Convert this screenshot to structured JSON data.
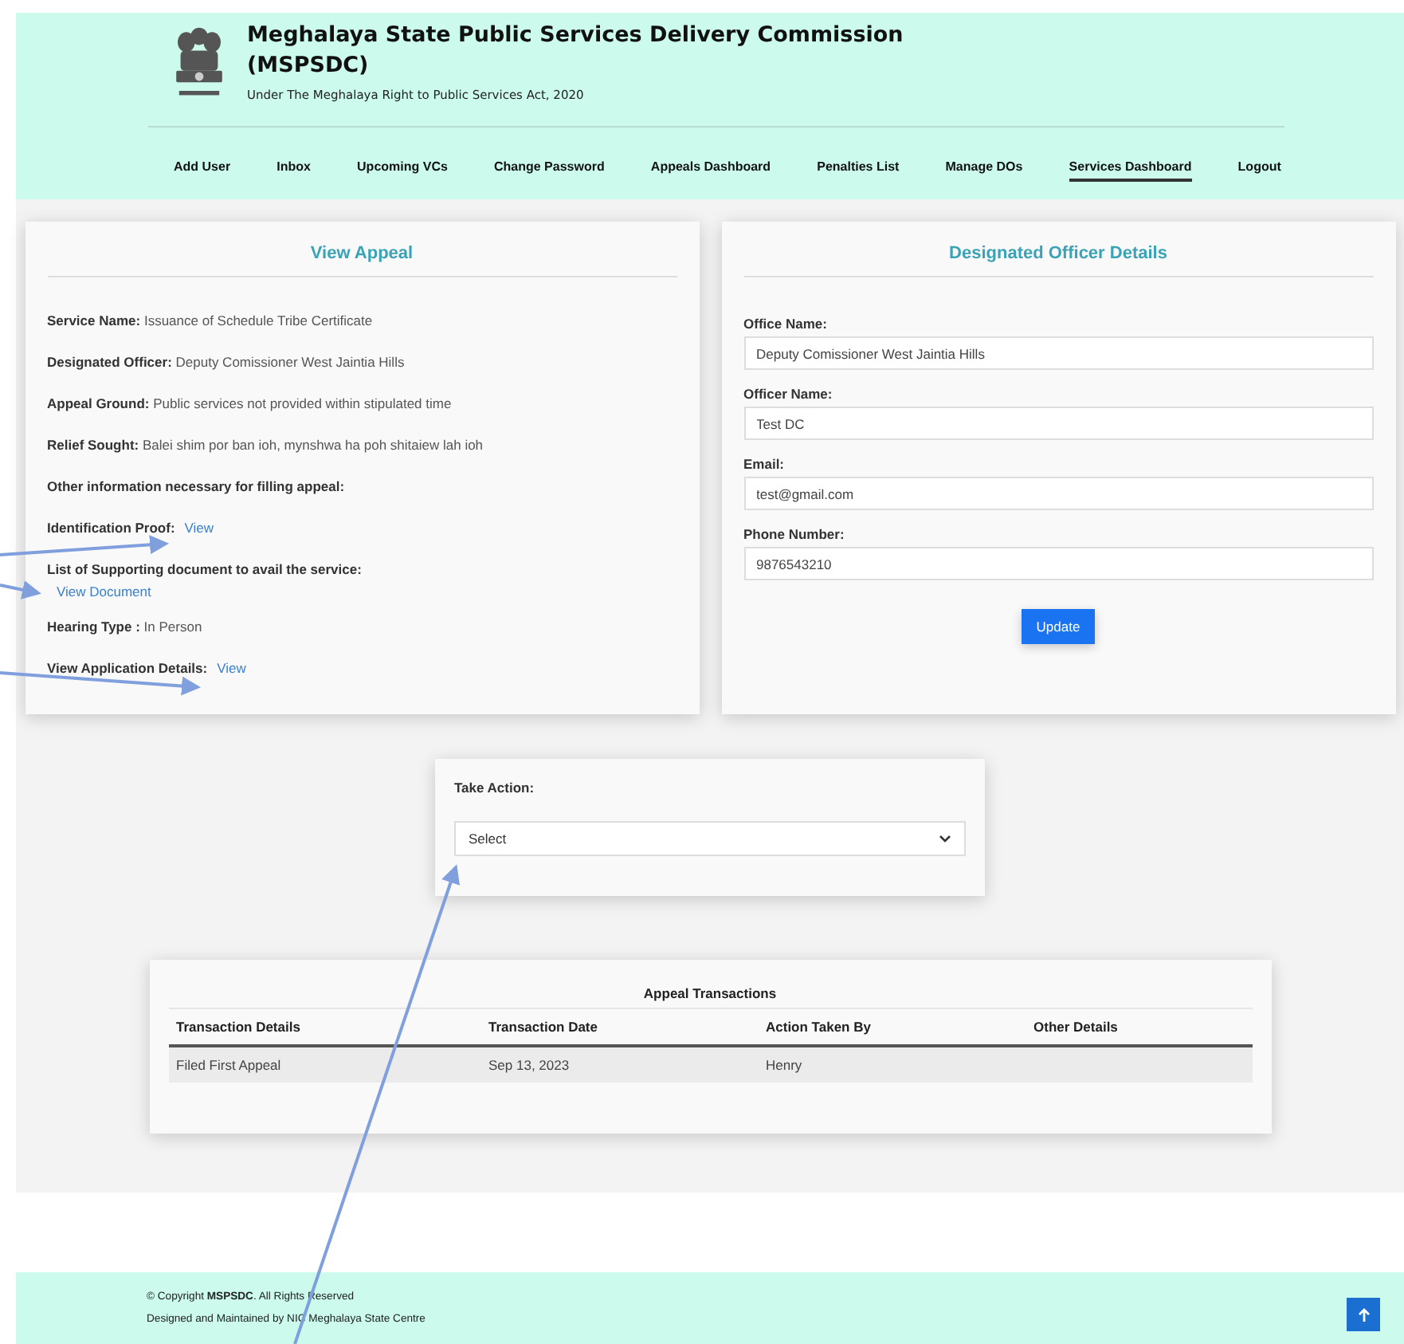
{
  "header": {
    "title_line1": "Meghalaya State Public Services Delivery Commission",
    "title_line2": "(MSPSDC)",
    "subtitle": "Under The Meghalaya Right to Public Services Act, 2020"
  },
  "nav": [
    {
      "label": "Add User",
      "selected": false
    },
    {
      "label": "Inbox",
      "selected": false
    },
    {
      "label": "Upcoming VCs",
      "selected": false
    },
    {
      "label": "Change Password",
      "selected": false
    },
    {
      "label": "Appeals Dashboard",
      "selected": false
    },
    {
      "label": "Penalties List",
      "selected": false
    },
    {
      "label": "Manage DOs",
      "selected": false
    },
    {
      "label": "Services Dashboard",
      "selected": true
    },
    {
      "label": "Logout",
      "selected": false
    }
  ],
  "view_appeal": {
    "title": "View Appeal",
    "fields": [
      {
        "kind": "text",
        "label": "Service Name:",
        "value": "Issuance of Schedule Tribe Certificate"
      },
      {
        "kind": "text",
        "label": "Designated Officer:",
        "value": "Deputy Comissioner West Jaintia Hills"
      },
      {
        "kind": "text",
        "label": "Appeal Ground:",
        "value": "Public services not provided within stipulated time"
      },
      {
        "kind": "text",
        "label": "Relief Sought:",
        "value": "Balei shim por ban ioh, mynshwa ha poh shitaiew lah ioh"
      },
      {
        "kind": "heading",
        "label": "Other information necessary for filling appeal:"
      },
      {
        "kind": "link",
        "label": "Identification Proof:",
        "link": "View"
      },
      {
        "kind": "link_below",
        "label": "List of Supporting document to avail the service:",
        "link": "View Document"
      },
      {
        "kind": "text",
        "label": "Hearing Type :",
        "value": "In Person"
      },
      {
        "kind": "link",
        "label": "View Application Details:",
        "link": "View"
      }
    ]
  },
  "officer": {
    "title": "Designated Officer Details",
    "fields": [
      {
        "label": "Office Name:",
        "value": "Deputy Comissioner West Jaintia Hills"
      },
      {
        "label": "Officer Name:",
        "value": "Test DC"
      },
      {
        "label": "Email:",
        "value": "test@gmail.com"
      },
      {
        "label": "Phone Number:",
        "value": "9876543210"
      }
    ],
    "button": "Update"
  },
  "take_action": {
    "label": "Take Action:",
    "value": "Select"
  },
  "transactions": {
    "title": "Appeal Transactions",
    "columns": [
      "Transaction Details",
      "Transaction Date",
      "Action Taken By",
      "Other Details"
    ],
    "rows": [
      [
        "Filed First Appeal",
        "Sep 13, 2023",
        "Henry",
        ""
      ]
    ]
  },
  "footer": {
    "copyright": "© Copyright **MSPSDC**. All Rights Reserved",
    "maintained": "Designed and Maintained by NIC Meghalaya State Centre"
  }
}
